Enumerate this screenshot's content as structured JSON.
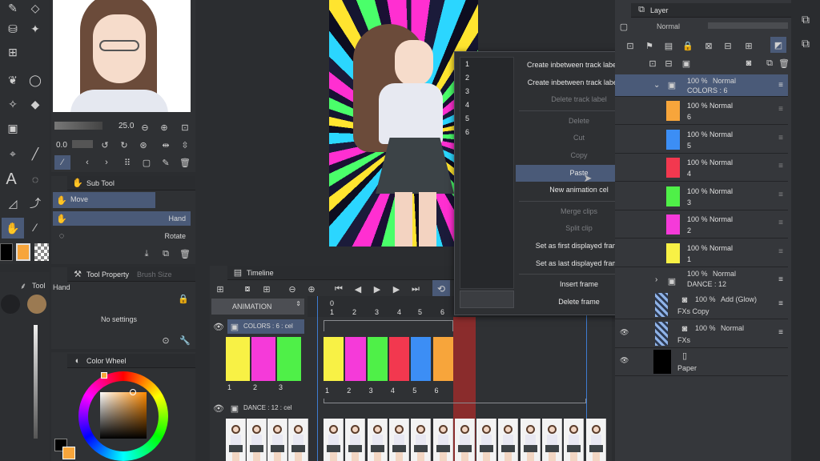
{
  "colors": {
    "accent": "#4a5a78",
    "selected_layer": "#4a5a78",
    "playhead": "#9a2c2c",
    "orange": "#f7a53b"
  },
  "left_toolbar": {
    "icons": [
      "pen-icon",
      "eraser-icon",
      "bucket-icon",
      "sparkle-icon",
      "grid-icon",
      "drops-icon",
      "lasso-icon",
      "magic-wand-icon",
      "fill-icon",
      "square-icon",
      "select-icon",
      "line-icon",
      "text-icon",
      "balloon-icon",
      "ruler-icon",
      "pipette-icon",
      "hand-icon",
      "eyedropper-icon"
    ]
  },
  "navigator": {
    "zoom_value": "25.0",
    "rotate_value": "0.0"
  },
  "sub_tool": {
    "title": "Sub Tool",
    "group": "Move",
    "items": [
      {
        "label": "Hand"
      },
      {
        "label": "Rotate"
      }
    ]
  },
  "tool_property": {
    "title": "Tool Property",
    "tab2": "Brush Size",
    "tool_name": "Hand",
    "message": "No settings"
  },
  "color_wheel": {
    "title": "Color Wheel"
  },
  "timeline": {
    "title": "Timeline",
    "track_name": "ANIMATION",
    "colors_label": "COLORS : 6 : cel",
    "dance_label": "DANCE : 12 : cel",
    "frame_numbers": [
      "0",
      "1",
      "2",
      "3",
      "4",
      "5",
      "6"
    ],
    "left_cells": [
      {
        "color": "#f8f145",
        "num": "1"
      },
      {
        "color": "#f53ad9",
        "num": "2"
      },
      {
        "color": "#4ff048",
        "num": "3"
      }
    ],
    "right_cells": [
      {
        "color": "#f8f145",
        "num": "1"
      },
      {
        "color": "#f53ad9",
        "num": "2"
      },
      {
        "color": "#4ff048",
        "num": "3"
      },
      {
        "color": "#f2384f",
        "num": "4"
      },
      {
        "color": "#3c8ef5",
        "num": "5"
      },
      {
        "color": "#f7a53b",
        "num": "6"
      }
    ]
  },
  "context_menu": {
    "list_items": [
      "1",
      "2",
      "3",
      "4",
      "5",
      "6"
    ],
    "items": [
      {
        "label": "Create inbetween track label \"O\"",
        "state": "enabled"
      },
      {
        "label": "Create inbetween track label \"●\"",
        "state": "enabled"
      },
      {
        "label": "Delete track label",
        "state": "disabled"
      },
      {
        "label": "",
        "state": "separator"
      },
      {
        "label": "Delete",
        "state": "disabled"
      },
      {
        "label": "Cut",
        "state": "disabled"
      },
      {
        "label": "Copy",
        "state": "disabled"
      },
      {
        "label": "Paste",
        "state": "highlighted"
      },
      {
        "label": "New animation cel",
        "state": "enabled"
      },
      {
        "label": "",
        "state": "separator"
      },
      {
        "label": "Merge clips",
        "state": "disabled"
      },
      {
        "label": "Split clip",
        "state": "disabled"
      },
      {
        "label": "Set as first displayed frame",
        "state": "enabled"
      },
      {
        "label": "Set as last displayed frame",
        "state": "enabled"
      },
      {
        "label": "",
        "state": "separator"
      },
      {
        "label": "Insert frame",
        "state": "enabled"
      },
      {
        "label": "Delete frame",
        "state": "enabled"
      }
    ]
  },
  "layer_panel": {
    "title": "Layer",
    "blend_mode": "Normal",
    "folder_colors": {
      "opacity": "100 %",
      "mode": "Normal",
      "name": "COLORS : 6"
    },
    "color_layers": [
      {
        "opacity": "100 %",
        "mode": "Normal",
        "name": "6",
        "color": "#f7a53b"
      },
      {
        "opacity": "100 %",
        "mode": "Normal",
        "name": "5",
        "color": "#3c8ef5"
      },
      {
        "opacity": "100 %",
        "mode": "Normal",
        "name": "4",
        "color": "#f2384f"
      },
      {
        "opacity": "100 %",
        "mode": "Normal",
        "name": "3",
        "color": "#4ff048"
      },
      {
        "opacity": "100 %",
        "mode": "Normal",
        "name": "2",
        "color": "#f53ad9"
      },
      {
        "opacity": "100 %",
        "mode": "Normal",
        "name": "1",
        "color": "#f8f145"
      }
    ],
    "folder_dance": {
      "opacity": "100 %",
      "mode": "Normal",
      "name": "DANCE : 12"
    },
    "fx_copy": {
      "opacity": "100 %",
      "mode": "Add (Glow)",
      "name": "FXs Copy"
    },
    "fx": {
      "opacity": "100 %",
      "mode": "Normal",
      "name": "FXs"
    },
    "paper": {
      "name": "Paper"
    }
  }
}
